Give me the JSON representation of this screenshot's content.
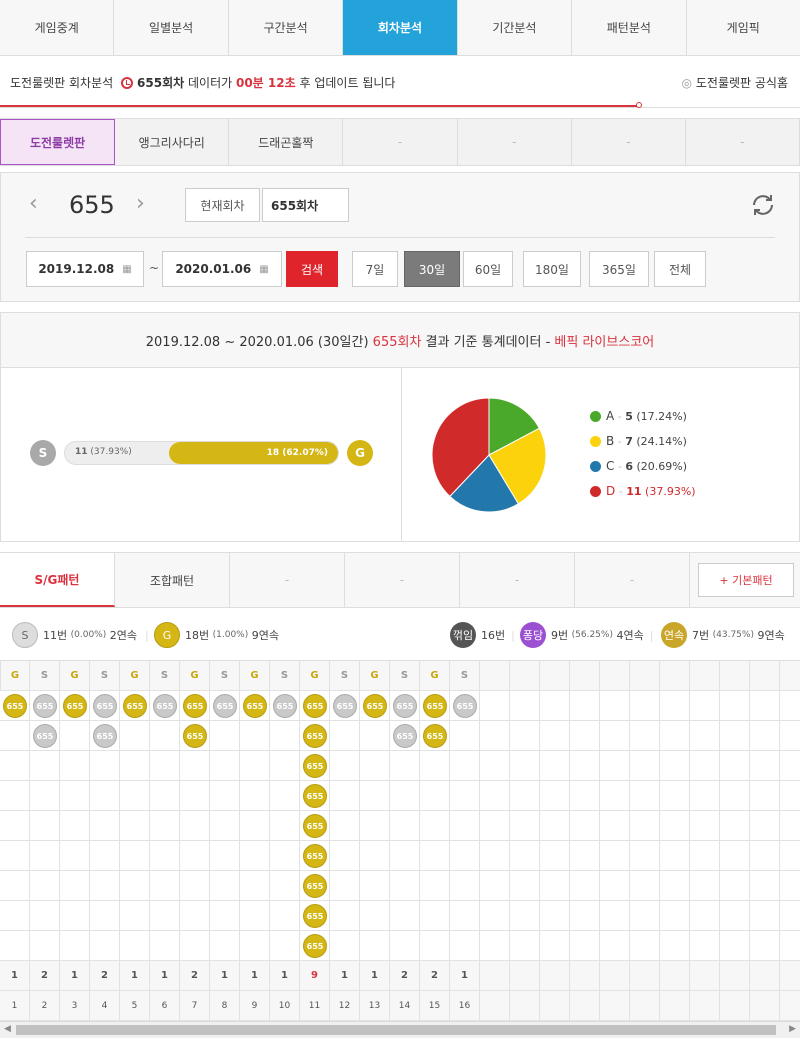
{
  "topnav": [
    "게임중계",
    "일별분석",
    "구간분석",
    "회차분석",
    "기간분석",
    "패턴분석",
    "게임픽"
  ],
  "topnav_active": 3,
  "notice": {
    "prefix": "도전룰렛판 회차분석",
    "round": "655회차",
    "mid": "데이터가",
    "time": "00분 12초",
    "suffix": "후 업데이트 됩니다",
    "home": "도전룰렛판 공식홈"
  },
  "gametabs": [
    "도전룰렛판",
    "앵그리사다리",
    "드래곤홀짝",
    "-",
    "-",
    "-",
    "-"
  ],
  "gametabs_active": 0,
  "round": {
    "number": "655",
    "current_btn": "현재회차",
    "input_value": "655회차"
  },
  "dates": {
    "start": "2019.12.08",
    "tilde": "~",
    "end": "2020.01.06",
    "search": "검색"
  },
  "periods": [
    "7일",
    "30일",
    "60일",
    "180일",
    "365일",
    "전체"
  ],
  "periods_active": 1,
  "stats_header": {
    "range": "2019.12.08 ~ 2020.01.06 (30일간)",
    "round": "655회차",
    "text": "결과 기준 통계데이터 -",
    "brand": "베픽 라이브스코어"
  },
  "sg_bar": {
    "s_label": "S",
    "g_label": "G",
    "s_text": "11",
    "s_pct": "(37.93%)",
    "g_text": "18 (62.07%)",
    "g_fraction": 0.6207
  },
  "pie": {
    "items": [
      {
        "name": "A",
        "count": "5",
        "pct": "(17.24%)",
        "value": 17.24,
        "color": "#4aa92a"
      },
      {
        "name": "B",
        "count": "7",
        "pct": "(24.14%)",
        "value": 24.14,
        "color": "#fcd20c"
      },
      {
        "name": "C",
        "count": "6",
        "pct": "(20.69%)",
        "value": 20.69,
        "color": "#2378ab"
      },
      {
        "name": "D",
        "count": "11",
        "pct": "(37.93%)",
        "value": 37.93,
        "color": "#d12a2a"
      }
    ]
  },
  "pattabs": [
    "S/G패턴",
    "조합패턴",
    "-",
    "-",
    "-",
    "-"
  ],
  "pattabs_active": 0,
  "basic_pattern_btn": "+ 기본패턴",
  "summary": {
    "s_badge": "S",
    "s_text": "11번",
    "s_pct": "(0.00%)",
    "s_streak": "2연속",
    "g_badge": "G",
    "g_text": "18번",
    "g_pct": "(1.00%)",
    "g_streak": "9연속",
    "turn_badge": "꺾임",
    "turn_text": "16번",
    "bounce_badge": "퐁당",
    "bounce_text": "9번",
    "bounce_pct": "(56.25%)",
    "bounce_streak": "4연속",
    "cont_badge": "연속",
    "cont_text": "7번",
    "cont_pct": "(43.75%)",
    "cont_streak": "9연속"
  },
  "grid": {
    "ball_label": "655",
    "columns": [
      {
        "type": "G",
        "count": 1
      },
      {
        "type": "S",
        "count": 2
      },
      {
        "type": "G",
        "count": 1
      },
      {
        "type": "S",
        "count": 2
      },
      {
        "type": "G",
        "count": 1
      },
      {
        "type": "S",
        "count": 1
      },
      {
        "type": "G",
        "count": 2
      },
      {
        "type": "S",
        "count": 1
      },
      {
        "type": "G",
        "count": 1
      },
      {
        "type": "S",
        "count": 1
      },
      {
        "type": "G",
        "count": 9
      },
      {
        "type": "S",
        "count": 1
      },
      {
        "type": "G",
        "count": 1
      },
      {
        "type": "S",
        "count": 2
      },
      {
        "type": "G",
        "count": 2
      },
      {
        "type": "S",
        "count": 1
      }
    ],
    "max_streak_col": 10,
    "index": [
      "1",
      "2",
      "3",
      "4",
      "5",
      "6",
      "7",
      "8",
      "9",
      "10",
      "11",
      "12",
      "13",
      "14",
      "15",
      "16"
    ],
    "colors": {
      "G": "#d4b614",
      "S": "#c9c9c9"
    }
  }
}
